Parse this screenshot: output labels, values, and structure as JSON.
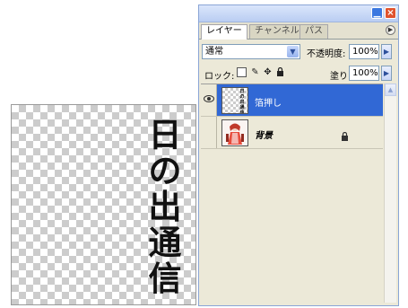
{
  "canvas": {
    "vertical_text": [
      "日",
      "の",
      "出",
      "通",
      "信"
    ]
  },
  "palette": {
    "tabs": [
      {
        "label": "レイヤー",
        "active": true
      },
      {
        "label": "チャンネル",
        "active": false
      },
      {
        "label": "パス",
        "active": false
      }
    ],
    "blend_mode": "通常",
    "opacity_label": "不透明度:",
    "opacity_value": "100%",
    "lock_label": "ロック:",
    "fill_label": "塗り:",
    "fill_value": "100%",
    "layers": [
      {
        "name": "箔押し",
        "visible": true,
        "selected": true,
        "locked": false
      },
      {
        "name": "背景",
        "visible": false,
        "selected": false,
        "locked": true
      }
    ],
    "colors": {
      "selected_row": "#3168d5",
      "panel_bg": "#ece9d8",
      "close_button": "#e0532e",
      "minimize_button": "#3b78e0"
    }
  }
}
